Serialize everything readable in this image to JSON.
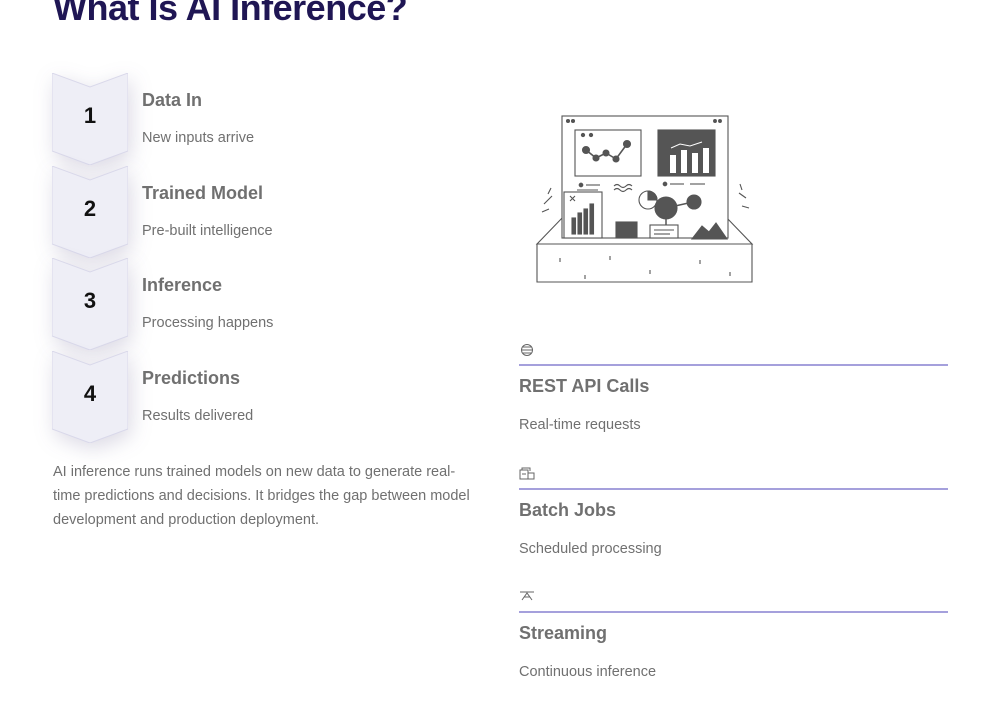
{
  "page": {
    "title": "What Is AI Inference?"
  },
  "steps": [
    {
      "number": "1",
      "title": "Data In",
      "subtitle": "New inputs arrive"
    },
    {
      "number": "2",
      "title": "Trained Model",
      "subtitle": "Pre-built intelligence"
    },
    {
      "number": "3",
      "title": "Inference",
      "subtitle": "Processing happens"
    },
    {
      "number": "4",
      "title": "Predictions",
      "subtitle": "Results delivered"
    }
  ],
  "description": "AI inference runs trained models on new data to generate real-time predictions and decisions. It bridges the gap between model development and production deployment.",
  "methods": [
    {
      "icon": "globe-icon",
      "title": "REST API Calls",
      "subtitle": "Real-time requests"
    },
    {
      "icon": "batch-stack-icon",
      "title": "Batch Jobs",
      "subtitle": "Scheduled processing"
    },
    {
      "icon": "stream-icon",
      "title": "Streaming",
      "subtitle": "Continuous inference"
    }
  ],
  "colors": {
    "title": "#1f1654",
    "accent_rule": "#a5a0dc",
    "body_text": "#707070",
    "chevron_fill": "#eeeef6"
  }
}
